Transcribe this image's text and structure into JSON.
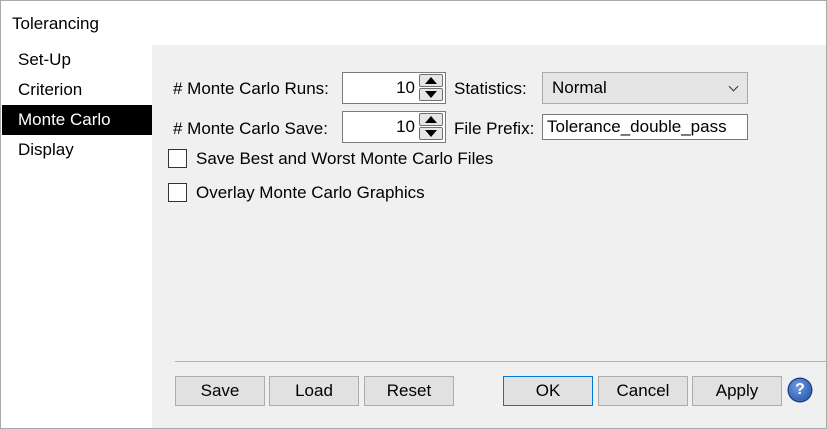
{
  "window": {
    "title": "Tolerancing"
  },
  "sidebar": {
    "items": [
      {
        "label": "Set-Up"
      },
      {
        "label": "Criterion"
      },
      {
        "label": "Monte Carlo"
      },
      {
        "label": "Display"
      }
    ],
    "active_index": 2
  },
  "monte_carlo": {
    "runs_label": "# Monte Carlo Runs:",
    "runs_value": "10",
    "save_label": "# Monte Carlo Save:",
    "save_value": "10",
    "statistics_label": "Statistics:",
    "statistics_value": "Normal",
    "file_prefix_label": "File Prefix:",
    "file_prefix_value": "Tolerance_double_pass",
    "save_best_worst_label": "Save Best and Worst Monte Carlo Files",
    "save_best_worst_checked": false,
    "overlay_graphics_label": "Overlay Monte Carlo Graphics",
    "overlay_graphics_checked": false
  },
  "buttons": {
    "save": "Save",
    "load": "Load",
    "reset": "Reset",
    "ok": "OK",
    "cancel": "Cancel",
    "apply": "Apply",
    "help": "?"
  },
  "icons": {
    "help": "help-icon",
    "spin_up": "arrow-up-icon",
    "spin_down": "arrow-down-icon",
    "dropdown": "chevron-down-icon"
  },
  "colors": {
    "sidebar_active_bg": "#000000",
    "panel_bg": "#f0f0f0",
    "default_button_border": "#0078d7"
  }
}
